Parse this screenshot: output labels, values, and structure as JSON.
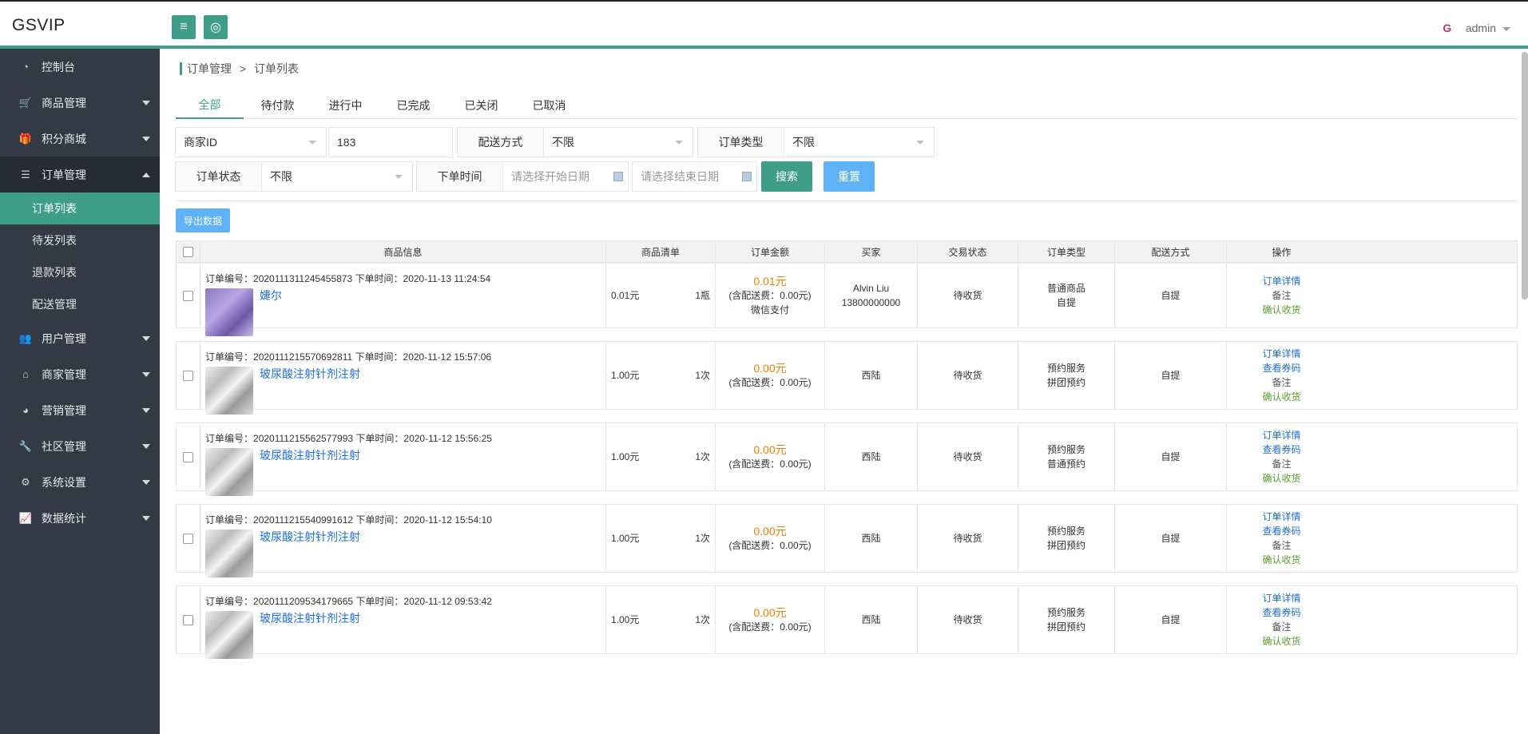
{
  "app": {
    "logo": "GSVIP"
  },
  "header": {
    "menu_icon": "menu-icon",
    "globe_icon": "globe-icon",
    "user_name": "admin",
    "avatar_text": "G"
  },
  "sidebar": {
    "items": [
      {
        "label": "控制台",
        "icon": "dashboard-icon",
        "has_arrow": false
      },
      {
        "label": "商品管理",
        "icon": "cart-icon",
        "has_arrow": true
      },
      {
        "label": "积分商城",
        "icon": "gift-icon",
        "has_arrow": true
      },
      {
        "label": "订单管理",
        "icon": "list-icon",
        "has_arrow": true,
        "open": true
      },
      {
        "label": "用户管理",
        "icon": "users-icon",
        "has_arrow": true
      },
      {
        "label": "商家管理",
        "icon": "home-icon",
        "has_arrow": true
      },
      {
        "label": "营销管理",
        "icon": "gauge-icon",
        "has_arrow": true
      },
      {
        "label": "社区管理",
        "icon": "wrench-icon",
        "has_arrow": true
      },
      {
        "label": "系统设置",
        "icon": "gears-icon",
        "has_arrow": true
      },
      {
        "label": "数据统计",
        "icon": "chart-icon",
        "has_arrow": true
      }
    ],
    "subitems": [
      {
        "label": "订单列表",
        "active": true
      },
      {
        "label": "待发列表"
      },
      {
        "label": "退款列表"
      },
      {
        "label": "配送管理"
      }
    ]
  },
  "breadcrumb": {
    "parent": "订单管理",
    "sep": ">",
    "current": "订单列表"
  },
  "tabs": [
    "全部",
    "待付款",
    "进行中",
    "已完成",
    "已关闭",
    "已取消"
  ],
  "filters": {
    "merchant_field": "商家ID",
    "merchant_value": "183",
    "delivery_label": "配送方式",
    "delivery_value": "不限",
    "order_type_label": "订单类型",
    "order_type_value": "不限",
    "status_label": "订单状态",
    "status_value": "不限",
    "time_label": "下单时间",
    "start_placeholder": "请选择开始日期",
    "end_placeholder": "请选择结束日期",
    "search_label": "搜索",
    "reset_label": "重置",
    "export_label": "导出数据"
  },
  "table": {
    "columns": [
      "商品信息",
      "商品清单",
      "订单金额",
      "买家",
      "交易状态",
      "订单类型",
      "配送方式",
      "操作"
    ],
    "order_no_prefix": "订单编号：",
    "time_prefix": "下单时间：",
    "rows": [
      {
        "order_no": "2020111311245455873",
        "time": "2020-11-13 11:24:54",
        "product": "婕尔",
        "price": "0.01元",
        "qty": "1瓶",
        "amount": "0.01元",
        "fee": "(含配送费：0.00元)",
        "pay": "微信支付",
        "buyer": "Alvin Liu",
        "buyer_phone": "13800000000",
        "status": "待收货",
        "type1": "普通商品",
        "type2": "自提",
        "delivery": "自提",
        "ops": [
          "订单详情",
          "备注",
          "确认收货"
        ]
      },
      {
        "order_no": "2020111215570692811",
        "time": "2020-11-12 15:57:06",
        "product": "玻尿酸注射针剂注射",
        "price": "1.00元",
        "qty": "1次",
        "amount": "0.00元",
        "fee": "(含配送费：0.00元)",
        "buyer": "西陆",
        "status": "待收货",
        "type1": "预约服务",
        "type2": "拼团预约",
        "delivery": "自提",
        "ops": [
          "订单详情",
          "查看券码",
          "备注",
          "确认收货"
        ]
      },
      {
        "order_no": "2020111215562577993",
        "time": "2020-11-12 15:56:25",
        "product": "玻尿酸注射针剂注射",
        "price": "1.00元",
        "qty": "1次",
        "amount": "0.00元",
        "fee": "(含配送费：0.00元)",
        "buyer": "西陆",
        "status": "待收货",
        "type1": "预约服务",
        "type2": "普通预约",
        "delivery": "自提",
        "ops": [
          "订单详情",
          "查看券码",
          "备注",
          "确认收货"
        ]
      },
      {
        "order_no": "2020111215540991612",
        "time": "2020-11-12 15:54:10",
        "product": "玻尿酸注射针剂注射",
        "price": "1.00元",
        "qty": "1次",
        "amount": "0.00元",
        "fee": "(含配送费：0.00元)",
        "buyer": "西陆",
        "status": "待收货",
        "type1": "预约服务",
        "type2": "拼团预约",
        "delivery": "自提",
        "ops": [
          "订单详情",
          "查看券码",
          "备注",
          "确认收货"
        ]
      },
      {
        "order_no": "2020111209534179665",
        "time": "2020-11-12 09:53:42",
        "product": "玻尿酸注射针剂注射",
        "price": "1.00元",
        "qty": "1次",
        "amount": "0.00元",
        "fee": "(含配送费：0.00元)",
        "buyer": "西陆",
        "status": "待收货",
        "type1": "预约服务",
        "type2": "拼团预约",
        "delivery": "自提",
        "ops": [
          "订单详情",
          "查看券码",
          "备注",
          "确认收货"
        ]
      }
    ]
  },
  "colors": {
    "accent": "#3f9e8a",
    "sidebar": "#333945",
    "link": "#1e6fd9",
    "amount": "#f57c00",
    "confirm": "#5a9e2f",
    "export": "#5fb2f5"
  }
}
